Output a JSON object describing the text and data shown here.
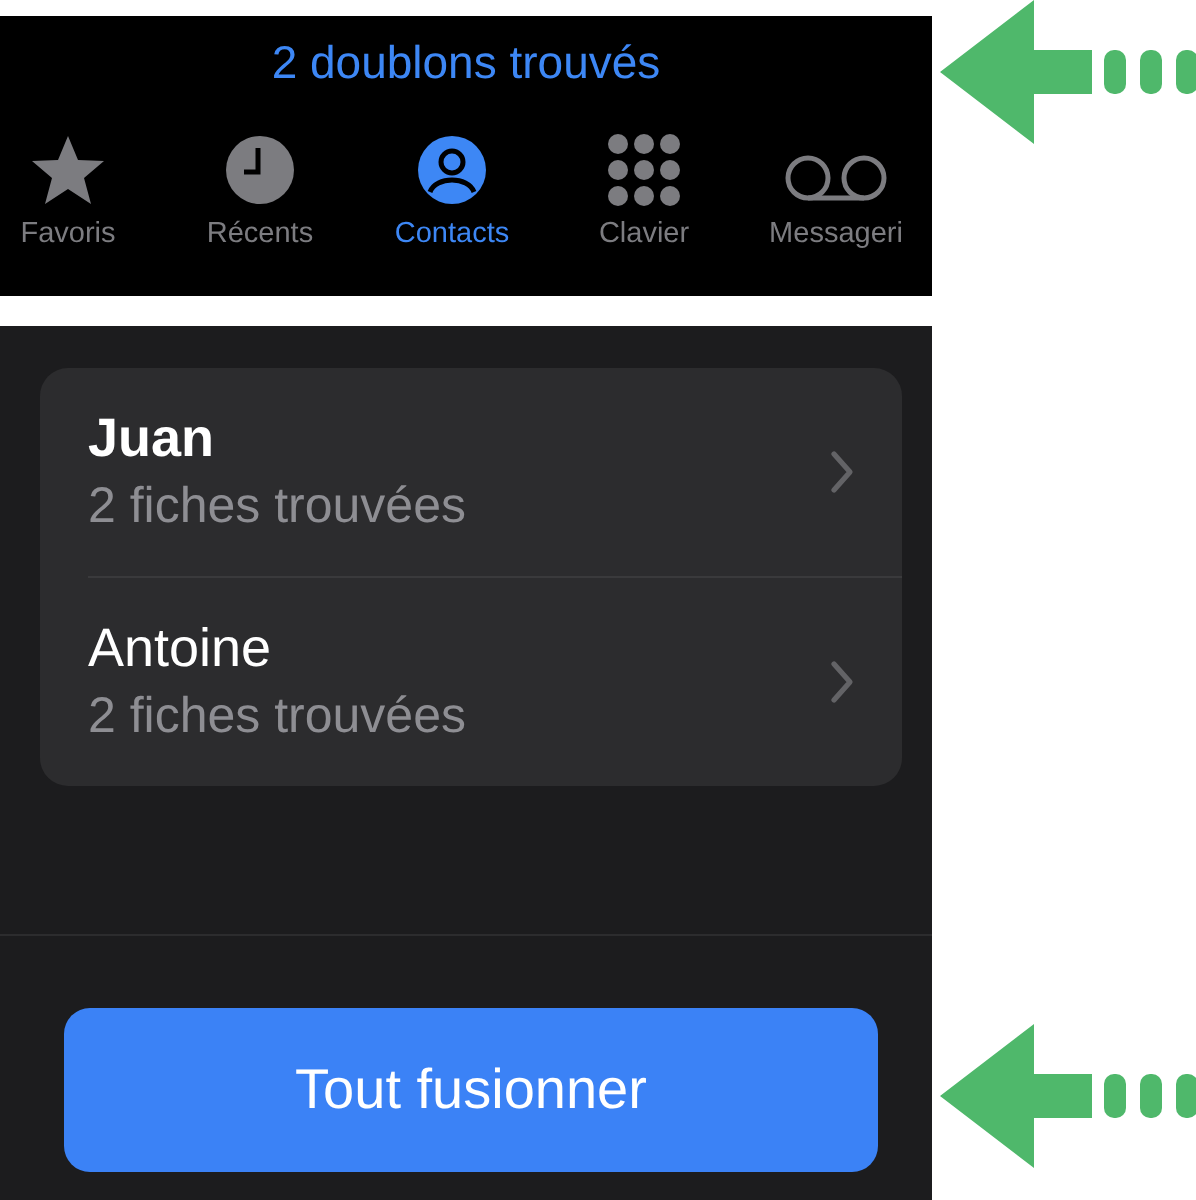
{
  "header": {
    "title": "2 doublons trouvés"
  },
  "tabs": [
    {
      "label": "Favoris",
      "kind": "star",
      "selected": false
    },
    {
      "label": "Récents",
      "kind": "clock",
      "selected": false
    },
    {
      "label": "Contacts",
      "kind": "person",
      "selected": true
    },
    {
      "label": "Clavier",
      "kind": "keypad",
      "selected": false
    },
    {
      "label": "Messageri",
      "kind": "voicemail",
      "selected": false
    }
  ],
  "duplicates": [
    {
      "name": "Juan",
      "detail": "2 fiches trouvées",
      "bold": true
    },
    {
      "name": "Antoine",
      "detail": "2 fiches trouvées",
      "bold": false
    }
  ],
  "merge_button": {
    "label": "Tout fusionner"
  }
}
